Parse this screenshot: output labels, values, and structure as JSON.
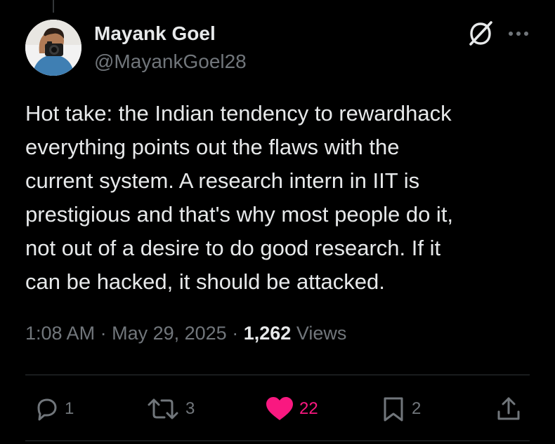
{
  "tweet": {
    "author": {
      "name": "Mayank Goel",
      "handle": "@MayankGoel28"
    },
    "text": "Hot take: the Indian tendency to rewardhack\neverything points out the flaws with the\ncurrent system. A research intern in IIT is\nprestigious and that's why most people do it,\nnot out of a desire to do good research. If it\ncan be hacked, it should be attacked.",
    "time": "1:08 AM",
    "separator": "·",
    "date": "May 29, 2025",
    "views_count": "1,262",
    "views_label": "Views",
    "icons": {
      "grok": "grok-icon",
      "more": "more-icon"
    }
  },
  "actions": {
    "replies": {
      "icon": "reply-icon",
      "count": "1"
    },
    "reposts": {
      "icon": "repost-icon",
      "count": "3"
    },
    "likes": {
      "icon": "heart-icon",
      "count": "22",
      "liked": true
    },
    "bookmarks": {
      "icon": "bookmark-icon",
      "count": "2"
    },
    "share": {
      "icon": "share-icon"
    }
  },
  "colors": {
    "background": "#000000",
    "text": "#e7e9ea",
    "secondary": "#71767b",
    "like": "#f91880",
    "divider": "#2f3336"
  }
}
